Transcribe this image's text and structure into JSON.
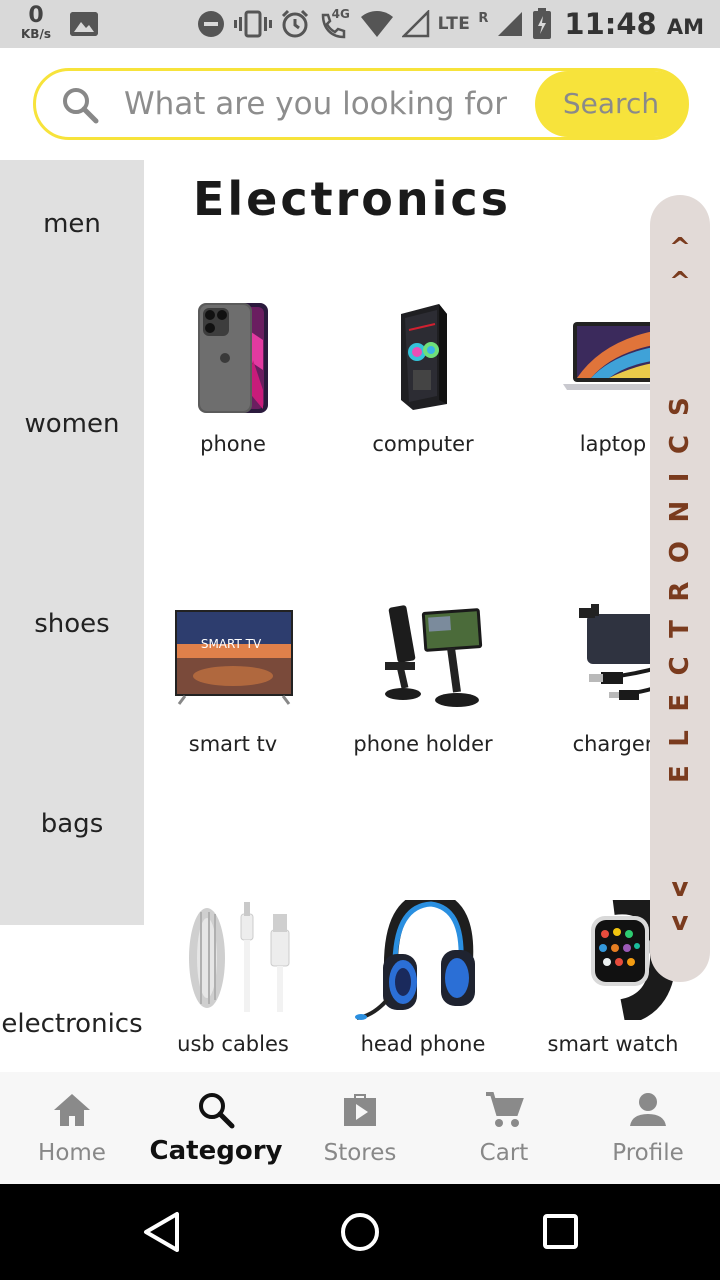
{
  "status_bar": {
    "net_speed_value": "0",
    "net_speed_unit": "KB/s",
    "network_label": "4G",
    "lte_label": "LTE",
    "roaming_label": "R",
    "time": "11:48",
    "ampm": "AM",
    "icons": [
      "image-icon",
      "do-not-disturb-icon",
      "vibrate-icon",
      "alarm-icon",
      "volte-call-icon",
      "wifi-icon",
      "signal-icon",
      "battery-charging-icon"
    ]
  },
  "search": {
    "placeholder": "What are you looking for",
    "value": "",
    "button_label": "Search",
    "accent_color": "#f7e33b"
  },
  "sidebar": {
    "items": [
      {
        "label": "men"
      },
      {
        "label": "women"
      },
      {
        "label": "shoes"
      },
      {
        "label": "bags"
      },
      {
        "label": "electronics",
        "selected": true
      }
    ]
  },
  "category": {
    "title": "Electronics",
    "products": [
      {
        "label": "phone",
        "icon": "phone-image"
      },
      {
        "label": "computer",
        "icon": "computer-image"
      },
      {
        "label": "laptop",
        "icon": "laptop-image"
      },
      {
        "label": "smart tv",
        "icon": "smart-tv-image",
        "screen_text": "SMART TV"
      },
      {
        "label": "phone holder",
        "icon": "phone-holder-image"
      },
      {
        "label": "charger",
        "icon": "charger-image"
      },
      {
        "label": "usb cables",
        "icon": "usb-cables-image"
      },
      {
        "label": "head phone",
        "icon": "headphone-image"
      },
      {
        "label": "smart watch",
        "icon": "smart-watch-image"
      }
    ]
  },
  "scroller": {
    "up_label": "^ ^",
    "word": "ELECTRONICS",
    "down_label": "v v",
    "color": "#7a3b1e"
  },
  "bottom_nav": {
    "items": [
      {
        "label": "Home",
        "icon": "home-icon"
      },
      {
        "label": "Category",
        "icon": "search-icon",
        "active": true
      },
      {
        "label": "Stores",
        "icon": "store-bag-icon"
      },
      {
        "label": "Cart",
        "icon": "cart-icon"
      },
      {
        "label": "Profile",
        "icon": "profile-icon"
      }
    ]
  }
}
